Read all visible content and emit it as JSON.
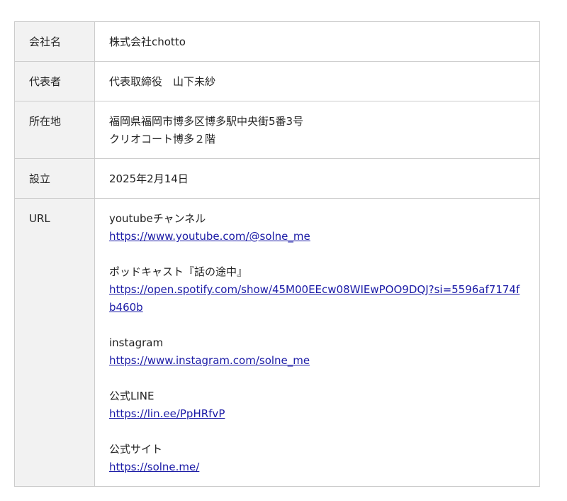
{
  "rows": [
    {
      "label": "会社名",
      "value": "株式会社chotto"
    },
    {
      "label": "代表者",
      "value": "代表取締役　山下未紗"
    },
    {
      "label": "所在地",
      "lines": [
        "福岡県福岡市博多区博多駅中央街5番3号",
        "クリオコート博多２階"
      ]
    },
    {
      "label": "設立",
      "value": "2025年2月14日"
    }
  ],
  "url_row": {
    "label": "URL",
    "links": [
      {
        "name": "youtubeチャンネル",
        "url": "https://www.youtube.com/@solne_me"
      },
      {
        "name": "ポッドキャスト『話の途中』",
        "url": "https://open.spotify.com/show/45M00EEcw08WIEwPOO9DQJ?si=5596af7174fb460b"
      },
      {
        "name": "instagram",
        "url": "https://www.instagram.com/solne_me"
      },
      {
        "name": "公式LINE",
        "url": "https://lin.ee/PpHRfvP"
      },
      {
        "name": "公式サイト",
        "url": "https://solne.me/"
      }
    ]
  },
  "colors": {
    "label_background": "#f2f2f2",
    "border": "#cccccc",
    "link": "#1a1aa6"
  }
}
